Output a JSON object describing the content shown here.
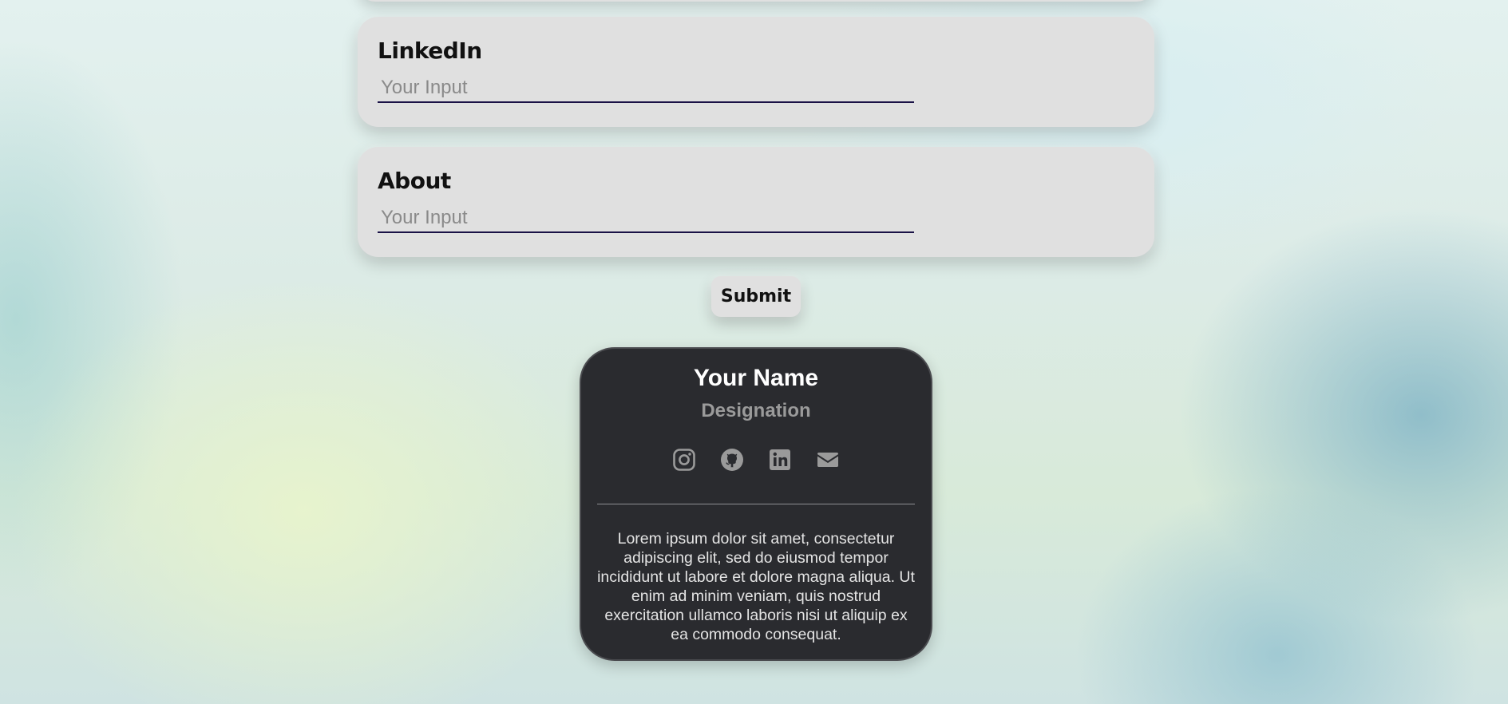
{
  "form": {
    "fields": [
      {
        "label": "LinkedIn",
        "placeholder": "Your Input",
        "value": ""
      },
      {
        "label": "About",
        "placeholder": "Your Input",
        "value": ""
      }
    ],
    "submit_label": "Submit"
  },
  "profile_card": {
    "name": "Your Name",
    "designation": "Designation",
    "social_icons": [
      "instagram-icon",
      "github-icon",
      "linkedin-icon",
      "email-icon"
    ],
    "icon_color": "#9a9a9a",
    "background_color": "#2a2b2f",
    "bio": "Lorem ipsum dolor sit amet, consectetur adipiscing elit, sed do eiusmod tempor incididunt ut labore et dolore magna aliqua. Ut enim ad minim veniam, quis nostrud exercitation ullamco laboris nisi ut aliquip ex ea commodo consequat."
  }
}
